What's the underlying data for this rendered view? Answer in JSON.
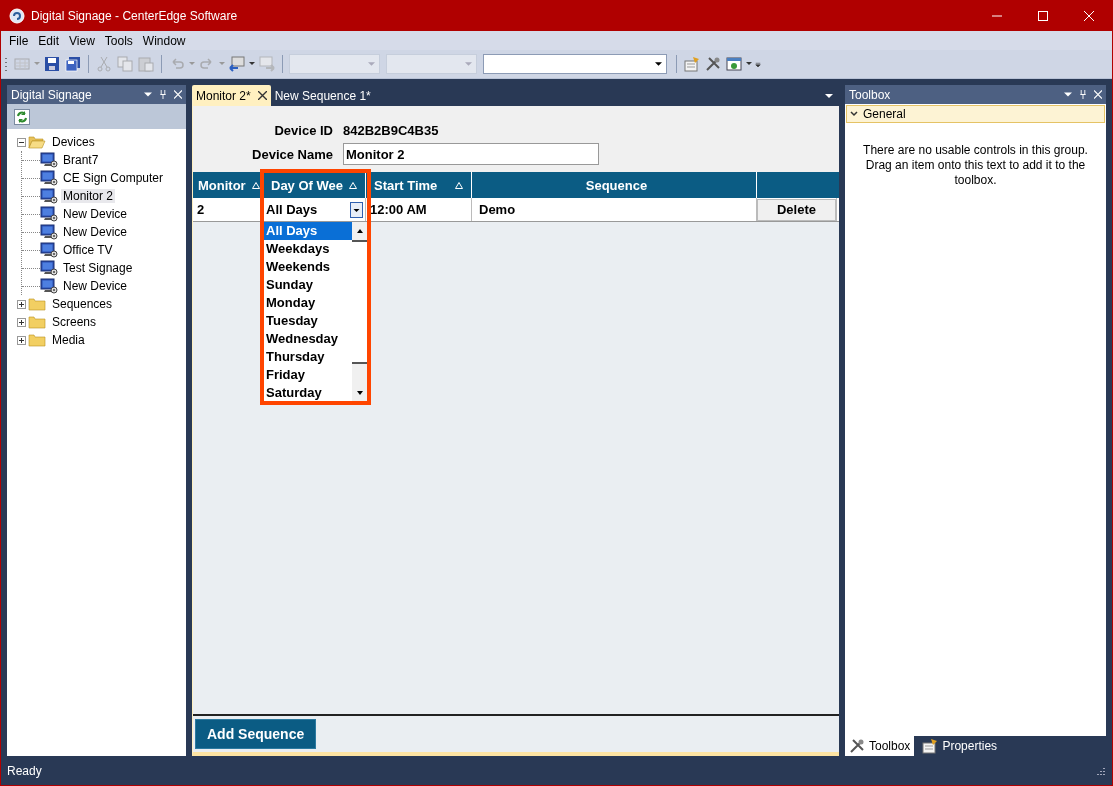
{
  "window": {
    "title": "Digital Signage - CenterEdge Software"
  },
  "menu": [
    "File",
    "Edit",
    "View",
    "Tools",
    "Window"
  ],
  "toolbar": {
    "combos": [
      {
        "disabled": true
      },
      {
        "disabled": true
      },
      {
        "disabled": false
      }
    ]
  },
  "left_panel": {
    "title": "Digital Signage",
    "tree": [
      {
        "label": "Devices",
        "expanded": true,
        "children": [
          {
            "label": "Brant7",
            "selected": false
          },
          {
            "label": "CE Sign Computer",
            "selected": false
          },
          {
            "label": "Monitor 2",
            "selected": true
          },
          {
            "label": "New Device",
            "selected": false
          },
          {
            "label": "New Device",
            "selected": false
          },
          {
            "label": "Office TV",
            "selected": false
          },
          {
            "label": "Test Signage",
            "selected": false
          },
          {
            "label": "New Device",
            "selected": false
          }
        ]
      },
      {
        "label": "Sequences",
        "expanded": false
      },
      {
        "label": "Screens",
        "expanded": false
      },
      {
        "label": "Media",
        "expanded": false
      }
    ]
  },
  "tabs": [
    {
      "label": "Monitor 2*",
      "selected": true
    },
    {
      "label": "New Sequence 1*",
      "selected": false
    }
  ],
  "device": {
    "id_label": "Device ID",
    "id": "842B2B9C4B35",
    "name_label": "Device Name",
    "name": "Monitor 2"
  },
  "grid": {
    "columns": [
      {
        "label": "Monitor",
        "sortable": true
      },
      {
        "label": "Day Of Wee",
        "sortable": true
      },
      {
        "label": "Start Time",
        "sortable": true
      },
      {
        "label": "Sequence",
        "sortable": false
      }
    ],
    "rows": [
      {
        "monitor": "2",
        "day": "All Days",
        "start": "12:00 AM",
        "sequence": "Demo",
        "action": "Delete"
      }
    ],
    "day_options": [
      {
        "label": "All Days",
        "selected": true
      },
      {
        "label": "Weekdays",
        "selected": false
      },
      {
        "label": "Weekends",
        "selected": false
      },
      {
        "label": "Sunday",
        "selected": false
      },
      {
        "label": "Monday",
        "selected": false
      },
      {
        "label": "Tuesday",
        "selected": false
      },
      {
        "label": "Wednesday",
        "selected": false
      },
      {
        "label": "Thursday",
        "selected": false
      },
      {
        "label": "Friday",
        "selected": false
      },
      {
        "label": "Saturday",
        "selected": false
      }
    ]
  },
  "add_button": "Add Sequence",
  "toolbox": {
    "title": "Toolbox",
    "group": "General",
    "message": "There are no usable controls in this group. Drag an item onto this text to add it to the toolbox.",
    "tabs": [
      {
        "label": "Toolbox",
        "selected": true
      },
      {
        "label": "Properties",
        "selected": false
      }
    ]
  },
  "status": "Ready"
}
